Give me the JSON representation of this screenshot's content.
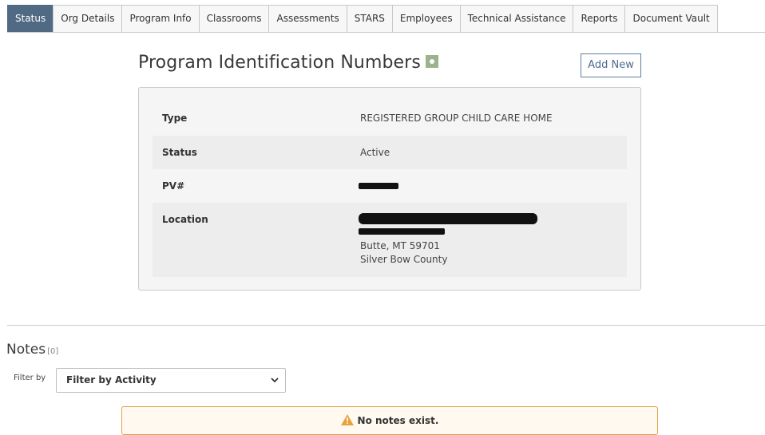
{
  "tabs": [
    {
      "label": "Status",
      "active": true
    },
    {
      "label": "Org Details",
      "active": false
    },
    {
      "label": "Program Info",
      "active": false
    },
    {
      "label": "Classrooms",
      "active": false
    },
    {
      "label": "Assessments",
      "active": false
    },
    {
      "label": "STARS",
      "active": false
    },
    {
      "label": "Employees",
      "active": false
    },
    {
      "label": "Technical Assistance",
      "active": false
    },
    {
      "label": "Reports",
      "active": false
    },
    {
      "label": "Document Vault",
      "active": false
    }
  ],
  "pin_section": {
    "title": "Program Identification Numbers",
    "info_icon": "info-badge-icon",
    "add_new_label": "Add New",
    "rows": {
      "type": {
        "label": "Type",
        "value": "REGISTERED GROUP CHILD CARE HOME"
      },
      "status": {
        "label": "Status",
        "value": "Active"
      },
      "pv": {
        "label": "PV#"
      },
      "location": {
        "label": "Location",
        "city_line": "Butte, MT  59701",
        "county_line": "Silver Bow County"
      }
    }
  },
  "notes": {
    "title": "Notes",
    "count": "[0]",
    "filter_label": "Filter by",
    "filter_selected": "Filter by Activity",
    "empty_message": "No notes exist."
  },
  "colors": {
    "active_tab": "#506a84",
    "add_new_border": "#5f7ea0",
    "info_badge": "#9bb38c",
    "warning_border": "#e0a04a",
    "warning_icon": "#e8a33d"
  }
}
